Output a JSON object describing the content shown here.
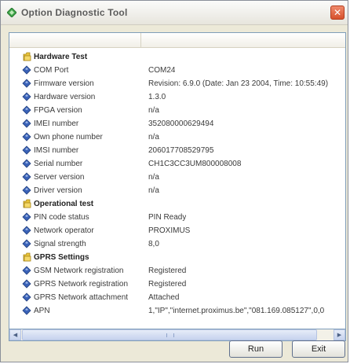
{
  "window": {
    "title": "Option Diagnostic Tool",
    "close_glyph": "✕"
  },
  "sections": [
    {
      "title": "Hardware Test",
      "icon": "folder-icon",
      "rows": [
        {
          "label": "COM Port",
          "value": "COM24"
        },
        {
          "label": "Firmware version",
          "value": "Revision: 6.9.0 (Date: Jan 23 2004, Time: 10:55:49)"
        },
        {
          "label": "Hardware version",
          "value": "1.3.0"
        },
        {
          "label": "FPGA version",
          "value": "n/a"
        },
        {
          "label": "IMEI number",
          "value": "352080000629494"
        },
        {
          "label": "Own phone number",
          "value": "n/a"
        },
        {
          "label": "IMSI number",
          "value": "206017708529795"
        },
        {
          "label": "Serial number",
          "value": "CH1C3CC3UM800008008"
        },
        {
          "label": "Server version",
          "value": "n/a"
        },
        {
          "label": "Driver version",
          "value": "n/a"
        }
      ]
    },
    {
      "title": "Operational test",
      "icon": "folder-icon",
      "rows": [
        {
          "label": "PIN code status",
          "value": "PIN Ready"
        },
        {
          "label": "Network operator",
          "value": "PROXIMUS"
        },
        {
          "label": "Signal strength",
          "value": "8,0"
        }
      ]
    },
    {
      "title": "GPRS Settings",
      "icon": "folder-icon",
      "rows": [
        {
          "label": "GSM Network registration",
          "value": "Registered"
        },
        {
          "label": "GPRS Network registration",
          "value": "Registered"
        },
        {
          "label": "GPRS Network attachment",
          "value": "Attached"
        },
        {
          "label": "APN",
          "value": "1,\"IP\",\"internet.proximus.be\",\"081.169.085127\",0,0"
        }
      ]
    }
  ],
  "buttons": {
    "run_label": "Run",
    "exit_label": "Exit"
  },
  "scrollbar": {
    "left_glyph": "◀",
    "right_glyph": "▶"
  },
  "colors": {
    "section_icon": "#e8c33a",
    "item_icon": "#3a62b8",
    "app_icon": "#3fa64a"
  }
}
